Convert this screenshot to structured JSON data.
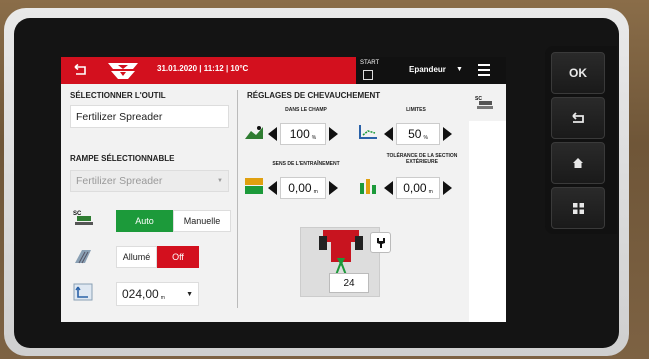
{
  "hardware": {
    "ok_label": "OK",
    "back_icon": "return-icon",
    "home_icon": "home-icon",
    "apps_icon": "grid-icon"
  },
  "topbar": {
    "back_icon": "back-arrow-icon",
    "info": "31.01.2020 | 11:12 | 10°C",
    "start_label": "START",
    "mode_label": "Epandeur",
    "brand_color": "#d3101e"
  },
  "left": {
    "tool_heading": "SÉLECTIONNER L'OUTIL",
    "tool_value": "Fertilizer Spreader",
    "boom_heading": "RAMPE SÉLECTIONNABLE",
    "boom_value": "Fertilizer Spreader",
    "mode_auto": "Auto",
    "mode_manual": "Manuelle",
    "on_label": "Allumé",
    "off_label": "Off",
    "distance_value": "024,00",
    "distance_unit": "m"
  },
  "right": {
    "heading": "RÉGLAGES DE CHEVAUCHEMENT",
    "field_caption": "DANS LE CHAMP",
    "limits_caption": "LIMITES",
    "field_value": "100",
    "field_unit": "%",
    "limits_value": "50",
    "limits_unit": "%",
    "drive_caption": "SENS DE L'ENTRAÎNEMENT",
    "tolerance_caption": "TOLÉRANCE DE LA SECTION EXTÉRIEURE",
    "drive_value": "0,00",
    "drive_unit": "m",
    "tolerance_value": "0,00",
    "tolerance_unit": "m",
    "counter_value": "24"
  },
  "colors": {
    "accent_red": "#d3101e",
    "active_green": "#1c9a3a"
  }
}
